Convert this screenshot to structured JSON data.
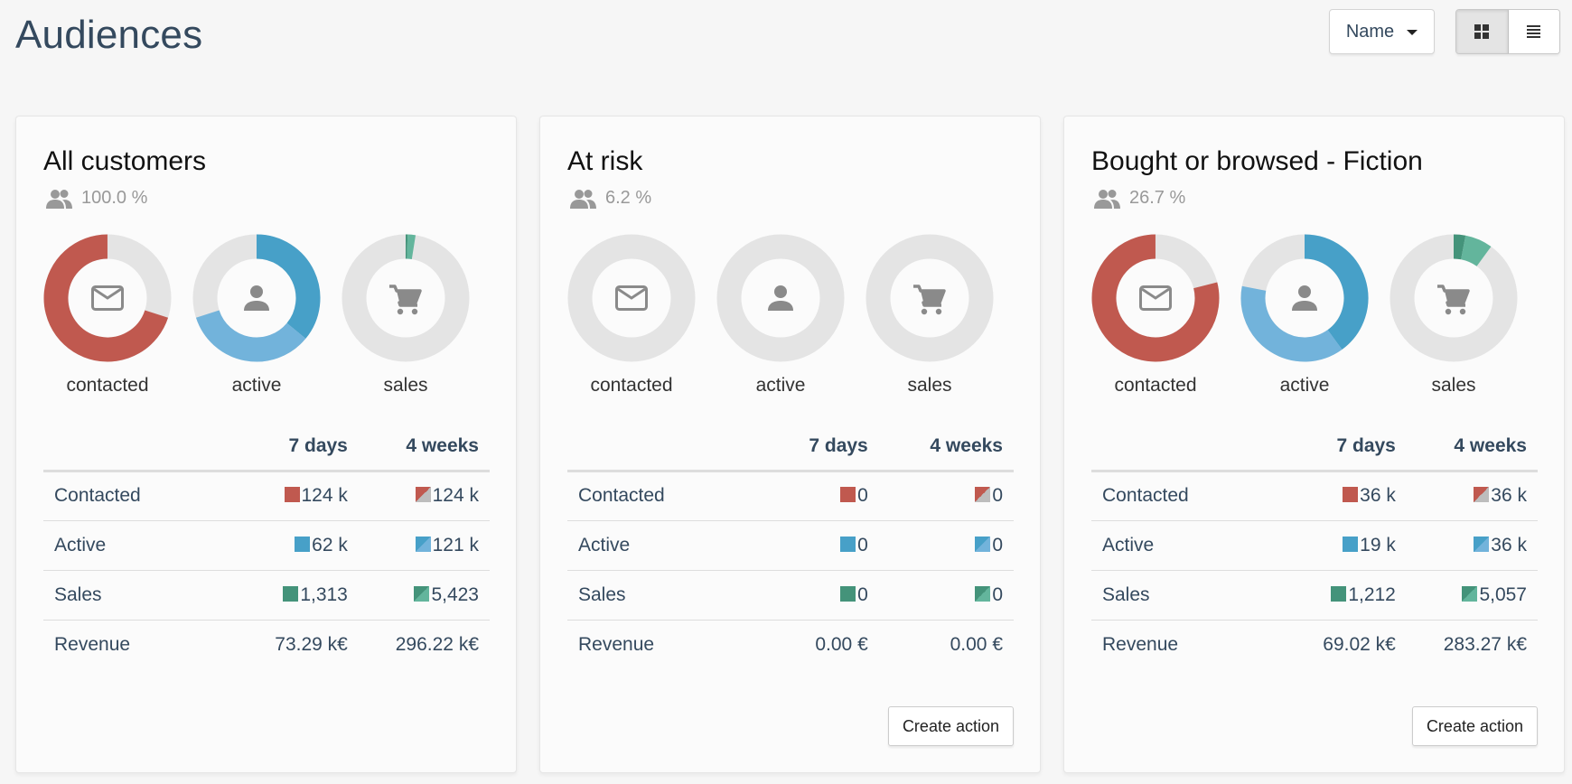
{
  "header": {
    "title": "Audiences",
    "sort_label": "Name",
    "view_modes": [
      {
        "name": "grid",
        "icon": "grid-icon",
        "active": true
      },
      {
        "name": "list",
        "icon": "list-icon",
        "active": false
      }
    ]
  },
  "colors": {
    "contacted": "#c0594f",
    "contacted_rest": "#bdbdbd",
    "active_7d": "#47a0c8",
    "active_4w": "#72b3db",
    "sales_7d": "#44937a",
    "sales_4w": "#63b59c",
    "track": "#e4e4e4",
    "icon": "#8a8a8a"
  },
  "table_headers": {
    "col1": "7 days",
    "col2": "4 weeks"
  },
  "donut_labels": {
    "contacted": "contacted",
    "active": "active",
    "sales": "sales"
  },
  "create_action_label": "Create action",
  "audiences": [
    {
      "title": "All customers",
      "share": "100.0 %",
      "has_create_action": false,
      "donuts": {
        "contacted": {
          "fraction": 0.7
        },
        "active": {
          "fraction_7d": 0.36,
          "fraction_4w": 0.7
        },
        "sales": {
          "fraction_7d": 0.005,
          "fraction_4w": 0.025
        }
      },
      "rows": [
        {
          "label": "Contacted",
          "d7": "124 k",
          "w4": "124 k",
          "kind": "contacted"
        },
        {
          "label": "Active",
          "d7": "62 k",
          "w4": "121 k",
          "kind": "active"
        },
        {
          "label": "Sales",
          "d7": "1,313",
          "w4": "5,423",
          "kind": "sales"
        },
        {
          "label": "Revenue",
          "d7": "73.29 k€",
          "w4": "296.22 k€",
          "kind": "revenue"
        }
      ]
    },
    {
      "title": "At risk",
      "share": "6.2 %",
      "has_create_action": true,
      "donuts": {
        "contacted": {
          "fraction": 0
        },
        "active": {
          "fraction_7d": 0,
          "fraction_4w": 0
        },
        "sales": {
          "fraction_7d": 0,
          "fraction_4w": 0
        }
      },
      "rows": [
        {
          "label": "Contacted",
          "d7": "0",
          "w4": "0",
          "kind": "contacted"
        },
        {
          "label": "Active",
          "d7": "0",
          "w4": "0",
          "kind": "active"
        },
        {
          "label": "Sales",
          "d7": "0",
          "w4": "0",
          "kind": "sales"
        },
        {
          "label": "Revenue",
          "d7": "0.00 €",
          "w4": "0.00 €",
          "kind": "revenue"
        }
      ]
    },
    {
      "title": "Bought or browsed - Fiction",
      "share": "26.7 %",
      "has_create_action": true,
      "donuts": {
        "contacted": {
          "fraction": 0.79
        },
        "active": {
          "fraction_7d": 0.4,
          "fraction_4w": 0.78
        },
        "sales": {
          "fraction_7d": 0.03,
          "fraction_4w": 0.1
        }
      },
      "rows": [
        {
          "label": "Contacted",
          "d7": "36 k",
          "w4": "36 k",
          "kind": "contacted"
        },
        {
          "label": "Active",
          "d7": "19 k",
          "w4": "36 k",
          "kind": "active"
        },
        {
          "label": "Sales",
          "d7": "1,212",
          "w4": "5,057",
          "kind": "sales"
        },
        {
          "label": "Revenue",
          "d7": "69.02 k€",
          "w4": "283.27 k€",
          "kind": "revenue"
        }
      ]
    }
  ]
}
